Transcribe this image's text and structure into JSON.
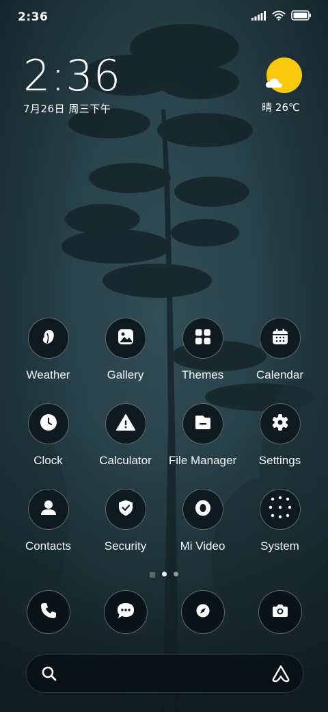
{
  "status": {
    "time": "2:36",
    "icons": [
      "signal-icon",
      "wifi-icon",
      "battery-icon"
    ]
  },
  "clock_widget": {
    "time": "2:36",
    "date": "7月26日 周三下午"
  },
  "weather_widget": {
    "condition_icon": "partly-sunny-icon",
    "text": "晴 26℃",
    "sun_color": "#f8c80f"
  },
  "apps": [
    {
      "label": "Weather",
      "icon": "weather-icon"
    },
    {
      "label": "Gallery",
      "icon": "gallery-icon"
    },
    {
      "label": "Themes",
      "icon": "themes-icon"
    },
    {
      "label": "Calendar",
      "icon": "calendar-icon"
    },
    {
      "label": "Clock",
      "icon": "clock-icon"
    },
    {
      "label": "Calculator",
      "icon": "calculator-icon"
    },
    {
      "label": "File Manager",
      "icon": "file-manager-icon"
    },
    {
      "label": "Settings",
      "icon": "settings-icon"
    },
    {
      "label": "Contacts",
      "icon": "contacts-icon"
    },
    {
      "label": "Security",
      "icon": "security-icon"
    },
    {
      "label": "Mi Video",
      "icon": "mi-video-icon"
    },
    {
      "label": "System",
      "icon": "system-folder-icon"
    }
  ],
  "pages": {
    "current": 1,
    "total": 2
  },
  "dock": [
    "phone-icon",
    "messages-icon",
    "browser-icon",
    "camera-icon"
  ],
  "search": {
    "left_icon": "search-icon",
    "right_icon": "assistant-icon"
  }
}
